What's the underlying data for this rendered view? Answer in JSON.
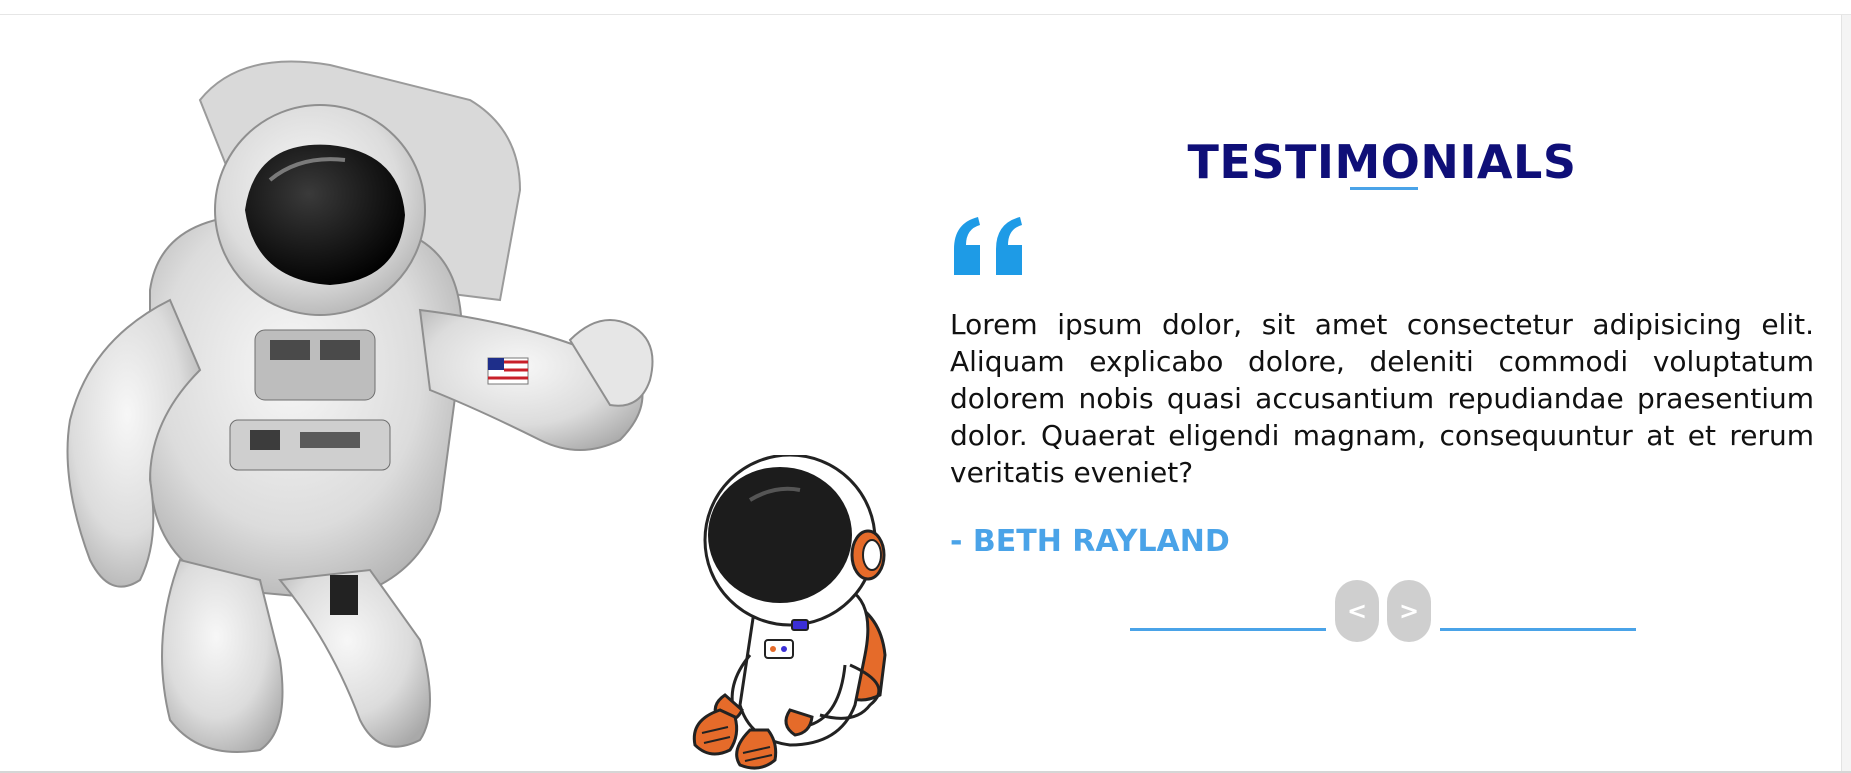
{
  "section": {
    "title": "TESTIMONIALS",
    "quote_icon": "quote-open-icon",
    "testimonial_text": "Lorem ipsum dolor, sit amet consectetur adipisicing elit. Aliquam explicabo dolore, deleniti commodi voluptatum dolorem nobis quasi accusantium repudiandae praesentium dolor. Quaerat eligendi magnam, consequuntur at et rerum veritatis eveniet?",
    "author": "- BETH RAYLAND"
  },
  "navigation": {
    "prev_label": "<",
    "next_label": ">"
  },
  "colors": {
    "title": "#0f0f78",
    "accent": "#4aa3e8",
    "quote_icon": "#1e9be6",
    "nav_button": "#cfcfcf",
    "text": "#111111"
  },
  "images": {
    "left_photo": "astronaut-photo",
    "cartoon": "cartoon-astronaut"
  }
}
